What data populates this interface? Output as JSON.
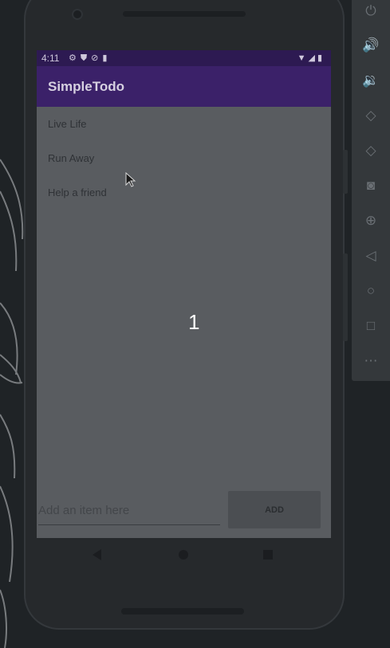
{
  "status_bar": {
    "time": "4:11",
    "left_icons": [
      "settings-icon",
      "shield-icon",
      "sync-off-icon",
      "sd-card-icon"
    ],
    "right_icons": [
      "wifi-icon",
      "signal-icon",
      "battery-icon"
    ]
  },
  "app": {
    "title": "SimpleTodo",
    "items": [
      {
        "label": "Live Life"
      },
      {
        "label": "Run Away"
      },
      {
        "label": "Help a friend"
      }
    ],
    "input_placeholder": "Add an item here",
    "add_button": "ADD"
  },
  "overlay": {
    "number": "1"
  },
  "navigation": [
    "back-icon",
    "home-icon",
    "overview-icon"
  ],
  "emulator_toolbar": [
    "power-icon",
    "volume-up-icon",
    "volume-down-icon",
    "rotate-left-icon",
    "rotate-right-icon",
    "camera-icon",
    "zoom-icon",
    "back-icon",
    "home-icon",
    "overview-icon",
    "more-icon"
  ],
  "colors": {
    "status_bar": "#2d1a52",
    "app_bar": "#3b2169",
    "screen_dim": "#595c60"
  }
}
